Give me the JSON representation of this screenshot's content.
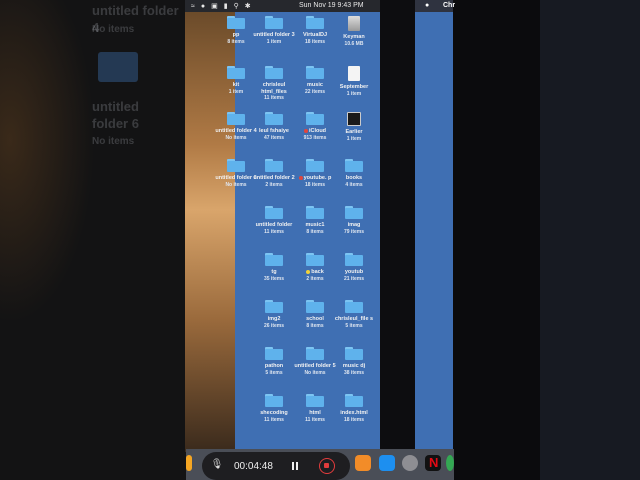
{
  "background": {
    "ghost_items": [
      {
        "name": "untitled folder 4",
        "count": "No items"
      },
      {
        "name": "untitled folder 6",
        "count": "No items"
      }
    ]
  },
  "menubar": {
    "time": "Sun Nov 19  9:43 PM",
    "right_app": "Chr"
  },
  "desktop": {
    "items": [
      {
        "name": "pp",
        "count": "8 items",
        "kind": "folder"
      },
      {
        "name": "untitled folder 3",
        "count": "1 item",
        "kind": "folder"
      },
      {
        "name": "VirtualDJ",
        "count": "18 items",
        "kind": "folder"
      },
      {
        "name": "Keyman",
        "count": "10.6 MB",
        "kind": "disk"
      },
      {
        "name": "kit",
        "count": "1 item",
        "kind": "folder"
      },
      {
        "name": "chrisleul html_files",
        "count": "11 items",
        "kind": "folder"
      },
      {
        "name": "music",
        "count": "22 items",
        "kind": "folder"
      },
      {
        "name": "September",
        "count": "1 item",
        "kind": "file"
      },
      {
        "name": "untitled folder 4",
        "count": "No items",
        "kind": "folder"
      },
      {
        "name": "leul fshaiye",
        "count": "47 items",
        "kind": "folder"
      },
      {
        "name": "iCloud",
        "count": "913 items",
        "kind": "folder",
        "tag": "#e0453c"
      },
      {
        "name": "Earlier",
        "count": "1 item",
        "kind": "dark"
      },
      {
        "name": "untitled folder 6",
        "count": "No items",
        "kind": "folder"
      },
      {
        "name": "untitled folder 2",
        "count": "2 items",
        "kind": "folder"
      },
      {
        "name": "youtube. p",
        "count": "18 items",
        "kind": "folder",
        "tag": "#e0453c"
      },
      {
        "name": "books",
        "count": "4 items",
        "kind": "folder"
      },
      {
        "name": "untitled folder",
        "count": "11 items",
        "kind": "folder"
      },
      {
        "name": "music1",
        "count": "8 items",
        "kind": "folder"
      },
      {
        "name": "imag",
        "count": "79 items",
        "kind": "folder"
      },
      {
        "name": "tg",
        "count": "35 items",
        "kind": "folder"
      },
      {
        "name": "back",
        "count": "2 items",
        "kind": "folder",
        "tag": "#f2d23a"
      },
      {
        "name": "youtub",
        "count": "21 items",
        "kind": "folder"
      },
      {
        "name": "img2",
        "count": "26 items",
        "kind": "folder"
      },
      {
        "name": "school",
        "count": "8 items",
        "kind": "folder"
      },
      {
        "name": "chrisleul_file s",
        "count": "5 items",
        "kind": "folder"
      },
      {
        "name": "pathon",
        "count": "5 items",
        "kind": "folder"
      },
      {
        "name": "untitled folder 5",
        "count": "No items",
        "kind": "folder"
      },
      {
        "name": "music dj",
        "count": "38 items",
        "kind": "folder"
      },
      {
        "name": "shecoding",
        "count": "11 items",
        "kind": "folder"
      },
      {
        "name": "html",
        "count": "11 items",
        "kind": "folder"
      },
      {
        "name": "index.html",
        "count": "18 items",
        "kind": "folder"
      }
    ]
  },
  "recorder": {
    "elapsed": "00:04:48"
  },
  "colors": {
    "desktop_bg": "#3f6fb3",
    "folder": "#5fb2ec",
    "record_red": "#e23c3c"
  }
}
